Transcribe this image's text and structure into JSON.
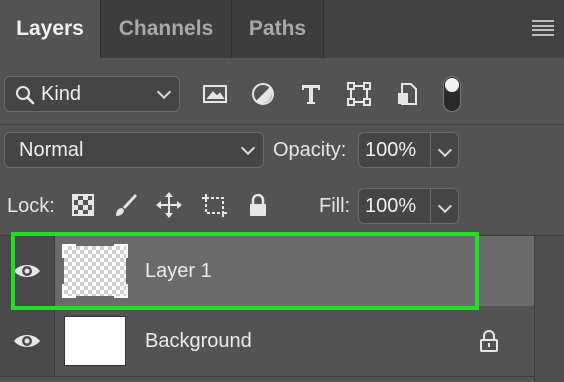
{
  "tabs": [
    {
      "label": "Layers",
      "active": true
    },
    {
      "label": "Channels",
      "active": false
    },
    {
      "label": "Paths",
      "active": false
    }
  ],
  "panel_menu_icon": "hamburger-menu-icon",
  "filter": {
    "kind_label": "Kind",
    "search_icon": "magnifier-icon",
    "icons": [
      "image-filter-icon",
      "adjustment-filter-icon",
      "type-filter-icon",
      "shape-filter-icon",
      "smart-object-filter-icon"
    ],
    "toggle_icon": "filter-toggle-icon"
  },
  "blend": {
    "mode": "Normal",
    "opacity_label": "Opacity:",
    "opacity_value": "100%"
  },
  "lock": {
    "label": "Lock:",
    "icons": [
      "lock-transparent-pixels-icon",
      "lock-image-pixels-icon",
      "lock-position-icon",
      "lock-artboard-icon",
      "lock-all-icon"
    ],
    "fill_label": "Fill:",
    "fill_value": "100%"
  },
  "layers": [
    {
      "name": "Layer 1",
      "visible": true,
      "selected": true,
      "thumbnail": "transparent",
      "locked": false
    },
    {
      "name": "Background",
      "visible": true,
      "selected": false,
      "thumbnail": "white",
      "locked": true
    }
  ],
  "colors": {
    "panel_bg": "#535353",
    "tab_bar_bg": "#424242",
    "selected_row_bg": "#6b6b6b",
    "highlight_outline": "#21df23"
  }
}
